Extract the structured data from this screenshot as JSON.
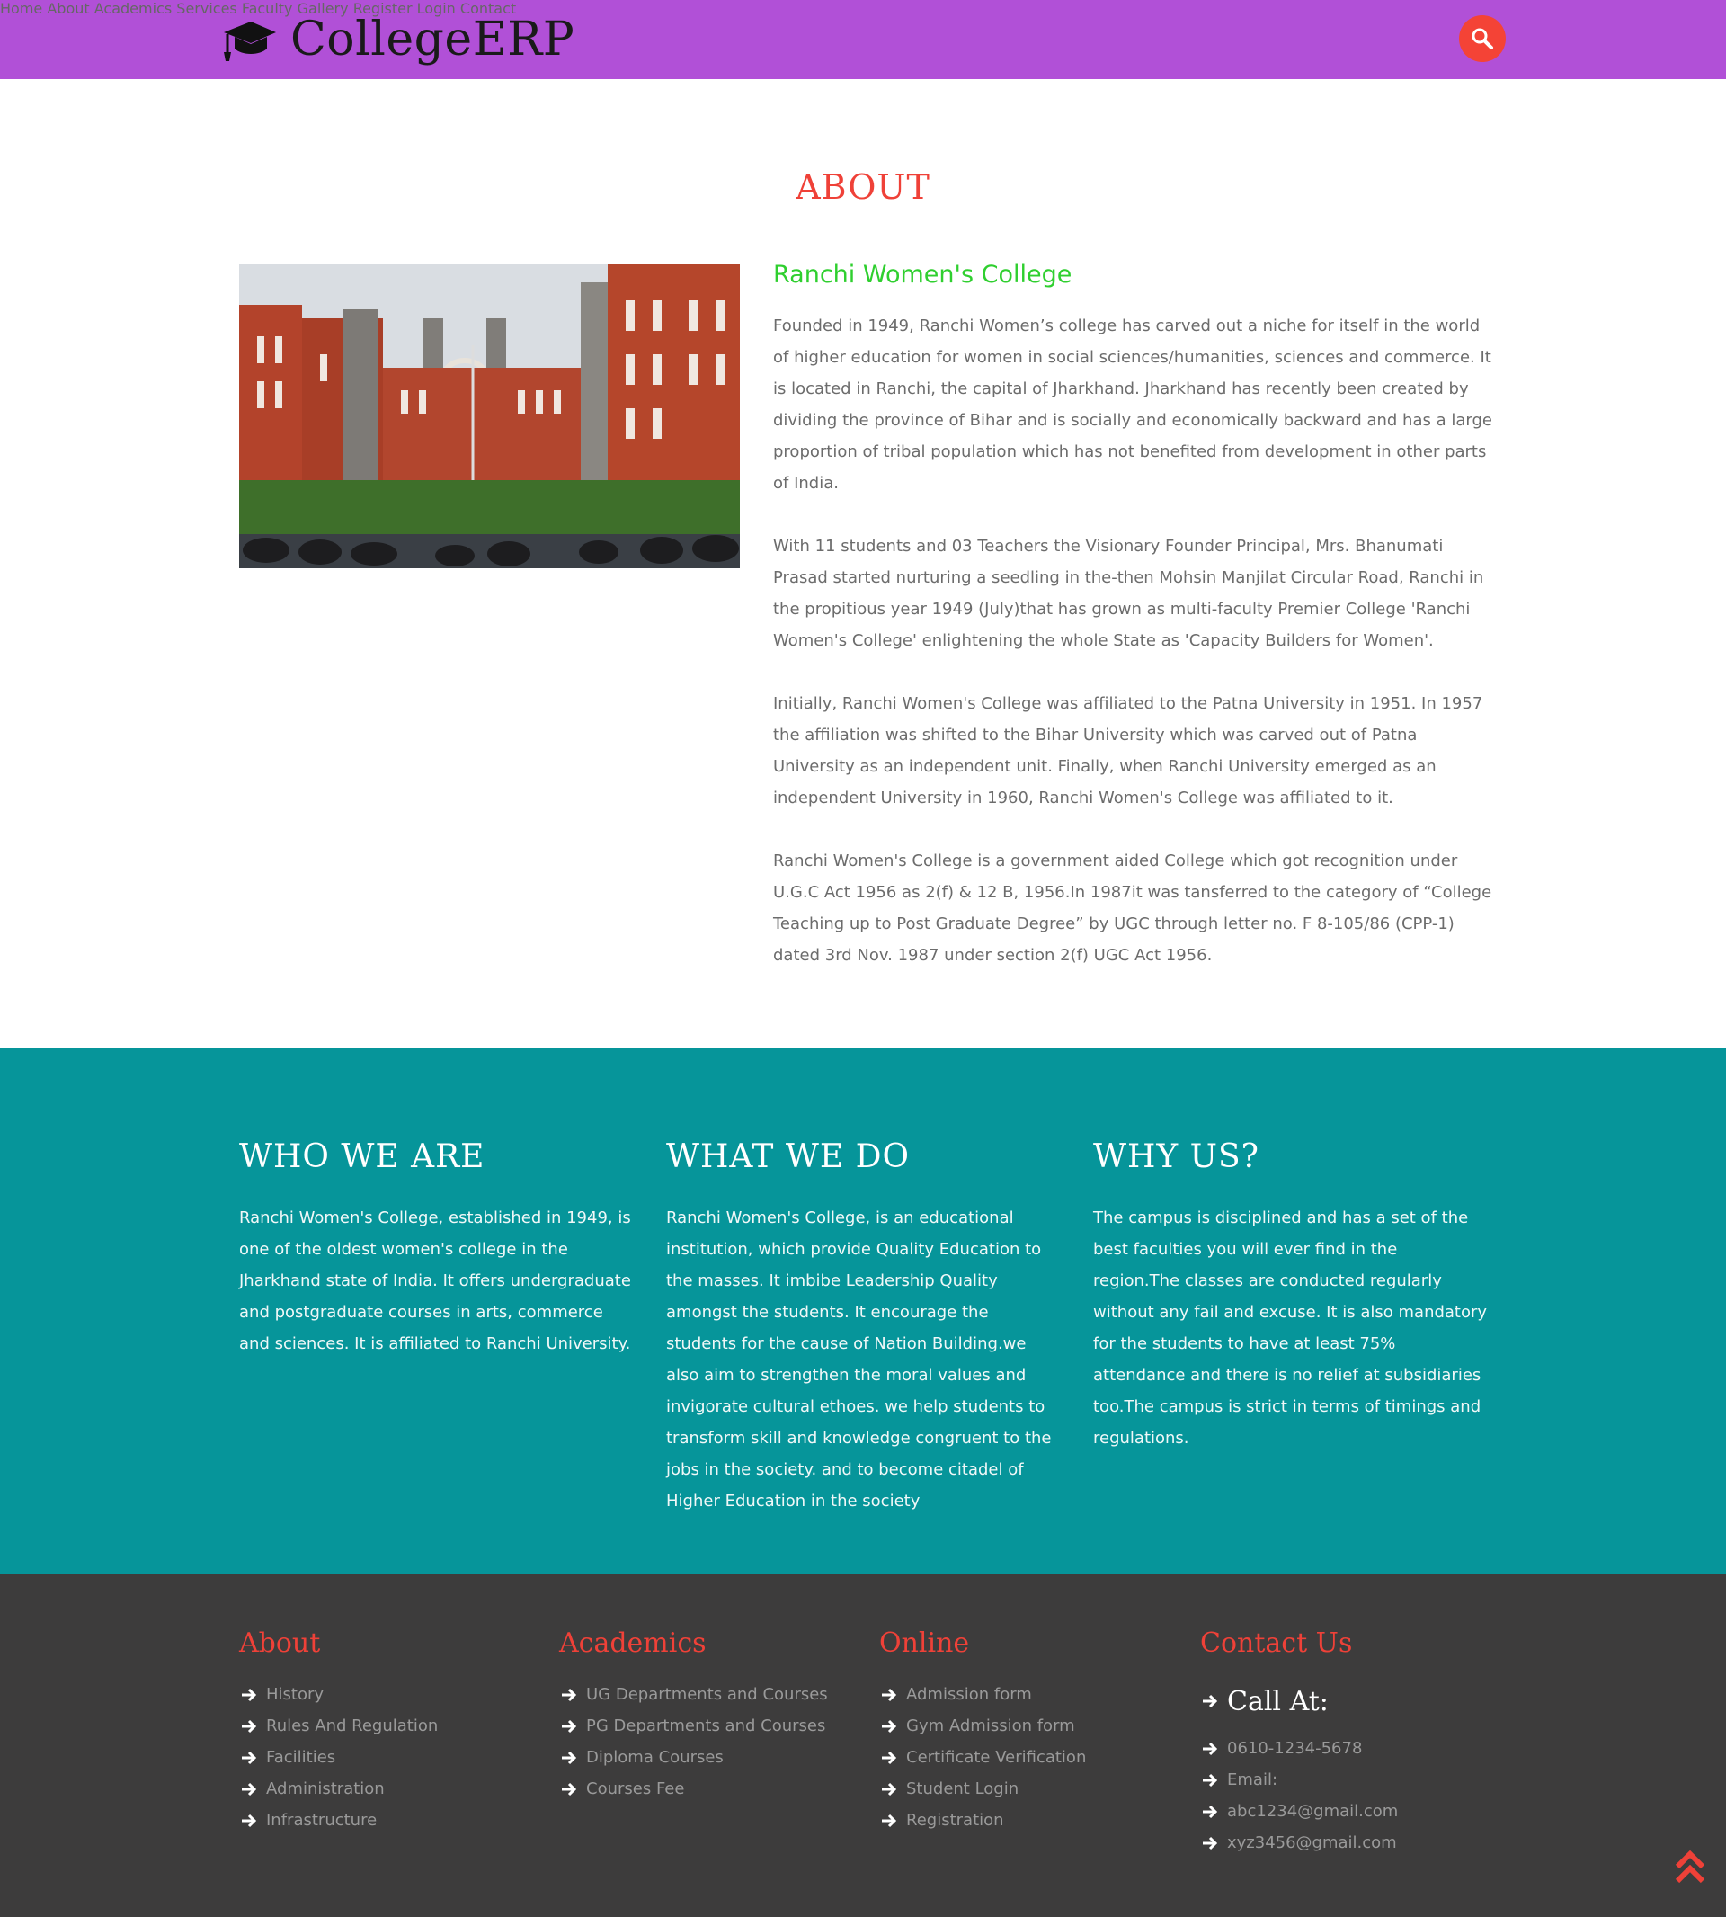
{
  "header": {
    "brand": "CollegeERP",
    "nav": [
      {
        "label": "Home"
      },
      {
        "label": "About"
      },
      {
        "label": "Academics"
      },
      {
        "label": "Services"
      },
      {
        "label": "Faculty"
      },
      {
        "label": "Gallery"
      },
      {
        "label": "Register"
      },
      {
        "label": "Login"
      },
      {
        "label": "Contact"
      }
    ],
    "search_icon": "search-icon"
  },
  "about": {
    "title": "ABOUT",
    "image_icon": "college-building-photo",
    "subtitle": "Ranchi Women's College",
    "paragraphs": [
      "Founded in 1949, Ranchi Women’s college has carved out a niche for itself in the world of higher education for women in social sciences/humanities, sciences and commerce. It is located in Ranchi, the capital of Jharkhand. Jharkhand has recently been created by dividing the province of Bihar and is socially and economically backward and has a large proportion of tribal population which has not benefited from development in other parts of India.",
      "With 11 students and 03 Teachers the Visionary Founder Principal, Mrs. Bhanumati Prasad started nurturing a seedling in the-then Mohsin Manjilat Circular Road, Ranchi in the propitious year 1949 (July)that has grown as multi-faculty Premier College 'Ranchi Women's College' enlightening the whole State as 'Capacity Builders for Women'.",
      "Initially, Ranchi Women's College was affiliated to the Patna University in 1951. In 1957 the affiliation was shifted to the Bihar University which was carved out of Patna University as an independent unit. Finally, when Ranchi University emerged as an independent University in 1960, Ranchi Women's College was affiliated to it.",
      "Ranchi Women's College is a government aided College which got recognition under U.G.C Act 1956 as 2(f) & 12 B, 1956.In 1987it was tansferred to the category of “College Teaching up to Post Graduate Degree” by UGC through letter no. F 8-105/86 (CPP-1) dated 3rd Nov. 1987 under section 2(f) UGC Act 1956."
    ]
  },
  "info": [
    {
      "title": "WHO WE ARE",
      "text": "Ranchi Women's College, established in 1949, is one of the oldest women's college in the Jharkhand state of India. It offers undergraduate and postgraduate courses in arts, commerce and sciences. It is affiliated to Ranchi University."
    },
    {
      "title": "WHAT WE DO",
      "text": "Ranchi Women's College, is an educational institution, which provide Quality Education to the masses. It imbibe Leadership Quality amongst the students. It encourage the students for the cause of Nation Building.we also aim to strengthen the moral values and invigorate cultural ethoes. we help students to transform skill and knowledge congruent to the jobs in the society. and to become citadel of Higher Education in the society"
    },
    {
      "title": "WHY US?",
      "text": "The campus is disciplined and has a set of the best faculties you will ever find in the region.The classes are conducted regularly without any fail and excuse. It is also mandatory for the students to have at least 75% attendance and there is no relief at subsidiaries too.The campus is strict in terms of timings and regulations."
    }
  ],
  "footer": {
    "about": {
      "title": "About",
      "links": [
        "History",
        "Rules And Regulation",
        "Facilities",
        "Administration",
        "Infrastructure"
      ]
    },
    "academics": {
      "title": "Academics",
      "links": [
        "UG Departments and Courses",
        "PG Departments and Courses",
        "Diploma Courses",
        "Courses Fee"
      ]
    },
    "online": {
      "title": "Online",
      "links": [
        "Admission form",
        "Gym Admission form",
        "Certificate Verification",
        "Student Login",
        "Registration"
      ]
    },
    "contact": {
      "title": "Contact Us",
      "call_label": "Call At:",
      "items": [
        "0610-1234-5678",
        "Email:",
        "abc1234@gmail.com",
        "xyz3456@gmail.com"
      ]
    }
  },
  "colors": {
    "navbar": "#b150d7",
    "accent_red": "#ef4138",
    "subtitle_green": "#2fcf2f",
    "teal": "#06959a",
    "footer": "#3d3c3c"
  },
  "scroll_top_icon": "double-chevron-up-icon"
}
